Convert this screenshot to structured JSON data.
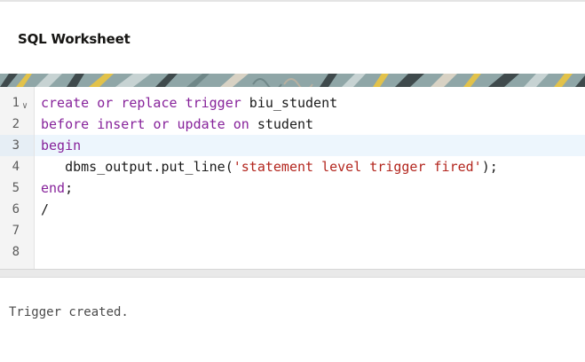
{
  "header": {
    "title": "SQL Worksheet"
  },
  "editor": {
    "lines": [
      {
        "num": "1",
        "tokens": [
          {
            "t": "create",
            "k": "kw"
          },
          {
            "t": " "
          },
          {
            "t": "or",
            "k": "kw"
          },
          {
            "t": " "
          },
          {
            "t": "replace",
            "k": "kw"
          },
          {
            "t": " "
          },
          {
            "t": "trigger",
            "k": "kw"
          },
          {
            "t": " biu_student"
          }
        ]
      },
      {
        "num": "2",
        "tokens": [
          {
            "t": "before",
            "k": "kw"
          },
          {
            "t": " "
          },
          {
            "t": "insert",
            "k": "kw"
          },
          {
            "t": " "
          },
          {
            "t": "or",
            "k": "kw"
          },
          {
            "t": " "
          },
          {
            "t": "update",
            "k": "kw"
          },
          {
            "t": " "
          },
          {
            "t": "on",
            "k": "kw"
          },
          {
            "t": " student"
          }
        ]
      },
      {
        "num": "3",
        "tokens": [
          {
            "t": "begin",
            "k": "kw"
          }
        ]
      },
      {
        "num": "4",
        "tokens": [
          {
            "t": "   dbms_output.put_line("
          },
          {
            "t": "'statement level trigger fired'",
            "k": "str"
          },
          {
            "t": ");"
          }
        ]
      },
      {
        "num": "5",
        "tokens": [
          {
            "t": "end",
            "k": "kw"
          },
          {
            "t": ";"
          }
        ]
      },
      {
        "num": "6",
        "tokens": [
          {
            "t": "/"
          }
        ]
      },
      {
        "num": "7",
        "tokens": []
      },
      {
        "num": "8",
        "tokens": []
      }
    ],
    "active_line": 3,
    "fold_icon": "chevron-down-icon"
  },
  "output": {
    "text": "Trigger created."
  },
  "colors": {
    "keyword": "#87239b",
    "string": "#b3261e",
    "banner_base": "#8fa6a7",
    "banner_yellow": "#e2c24a",
    "banner_dark": "#3f4a4c"
  }
}
